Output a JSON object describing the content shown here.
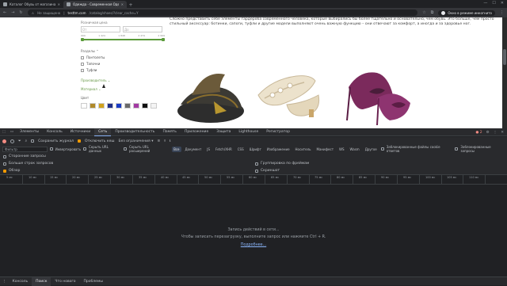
{
  "browser": {
    "tabs": [
      {
        "title": "Каталог Обувь от магазина Оф",
        "active": false
      },
      {
        "title": "Одежда - Современная Одеж",
        "active": true
      }
    ],
    "new_tab_icon": "plus-icon",
    "security_label": "Не защищено",
    "url_host": "testtm.com",
    "url_path": "/catalog/shoes/?clear_cache=Y",
    "incognito_label": "Окно в режиме инкогнито"
  },
  "page": {
    "price_label": "Розничная цена",
    "price_from_placeholder": "От",
    "price_to_placeholder": "До",
    "price_ticks": [
      "999",
      "1 424",
      "1 848",
      "2 474",
      "2 999"
    ],
    "sections_label": "Разделы",
    "section_items": [
      "Пантолеты",
      "Тапочки",
      "Туфли"
    ],
    "producer_label": "Производитель",
    "material_label": "Материал",
    "color_label": "Цвет",
    "swatch_colors": [
      "#ffffff",
      "#b08a2a",
      "#d1a21c",
      "#1f2f8a",
      "#1a3cc4",
      "#6a6a6a",
      "#a33aa3",
      "#111111",
      "#f4f4f4"
    ],
    "description": "Сложно представить себе элементы гардероба современного человека, которые выбирались бы более тщательно и основательно, чем обувь. Это больше, чем просто стильный аксессуар: ботинки, сапоги, туфли и другие модели выполняют очень важную функцию – они отвечают за комфорт, а иногда и за здоровье ног."
  },
  "devtools": {
    "panels": [
      "Элементы",
      "Консоль",
      "Источники",
      "Сеть",
      "Производительность",
      "Память",
      "Приложение",
      "Защита",
      "Lighthouse",
      "Регистратор"
    ],
    "active_panel": "Сеть",
    "error_count": "2",
    "toolbar": {
      "preserve_log": "Сохранить журнал",
      "disable_cache": "Отключить кеш",
      "throttling": "Без ограничения"
    },
    "filter": {
      "placeholder": "Фильтр",
      "invert": "Инвертировать",
      "hide_data_urls": "Скрыть URL данных",
      "hide_extension_urls": "Скрыть URL расширений",
      "types": [
        "Все",
        "Документ",
        "JS",
        "Fetch/XHR",
        "CSS",
        "Шрифт",
        "Изображение",
        "Носитель",
        "Манифест",
        "WS",
        "Wasm",
        "Другое"
      ],
      "active_type": "Все",
      "blocked_cookies": "Заблокированные файлы cookie ответов",
      "blocked_requests": "Заблокированные запросы"
    },
    "options": {
      "third_party": "Сторонние запросы",
      "big_rows": "Больше строк запросов",
      "overview": "Обзор",
      "group_by_frame": "Группировка по фреймам",
      "screenshots": "Скриншот"
    },
    "timeline_ticks": [
      "5 мс",
      "10 мс",
      "15 мс",
      "20 мс",
      "25 мс",
      "30 мс",
      "35 мс",
      "40 мс",
      "45 мс",
      "50 мс",
      "55 мс",
      "60 мс",
      "65 мс",
      "70 мс",
      "75 мс",
      "80 мс",
      "85 мс",
      "90 мс",
      "95 мс",
      "100 мс",
      "105 мс",
      "110 мс"
    ],
    "empty": {
      "line1": "Запись действий в сети...",
      "line2": "Чтобы записать перезагрузку, выполните запрос или нажмите Ctrl + R.",
      "link": "Подробнее..."
    },
    "drawer_tabs": [
      "Консоль",
      "Поиск",
      "Что нового",
      "Проблемы"
    ],
    "active_drawer_tab": "Поиск"
  }
}
